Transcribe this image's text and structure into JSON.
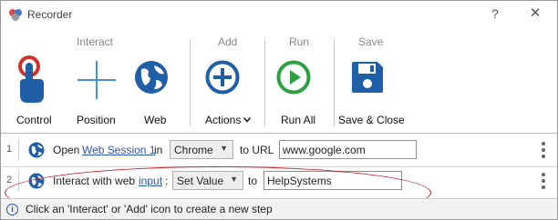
{
  "window": {
    "title": "Recorder"
  },
  "titlebar": {
    "help_label": "?",
    "close_label": "✕"
  },
  "toolbar": {
    "groups": {
      "interact": "Interact",
      "add": "Add",
      "run": "Run",
      "save": "Save"
    },
    "buttons": {
      "control": "Control",
      "position": "Position",
      "web": "Web",
      "actions": "Actions",
      "run_all": "Run All",
      "save_close": "Save & Close"
    },
    "colors": {
      "icon_blue": "#1f5fa8",
      "run_green": "#2ea043",
      "control_red": "#d0312d"
    }
  },
  "steps": [
    {
      "number": "1",
      "icon": "globe-icon",
      "prefix": "Open",
      "link": "Web Session 1",
      "middle": "in",
      "select": "Chrome",
      "to_label": "to URL",
      "value": "www.google.com"
    },
    {
      "number": "2",
      "icon": "globe-icon",
      "prefix": "Interact with web",
      "link": "input",
      "colon": ":",
      "select": "Set Value",
      "to_label": "to",
      "value": "HelpSystems"
    }
  ],
  "status": {
    "icon": "info-icon",
    "text": "Click an 'Interact' or 'Add' icon to create a new step"
  }
}
